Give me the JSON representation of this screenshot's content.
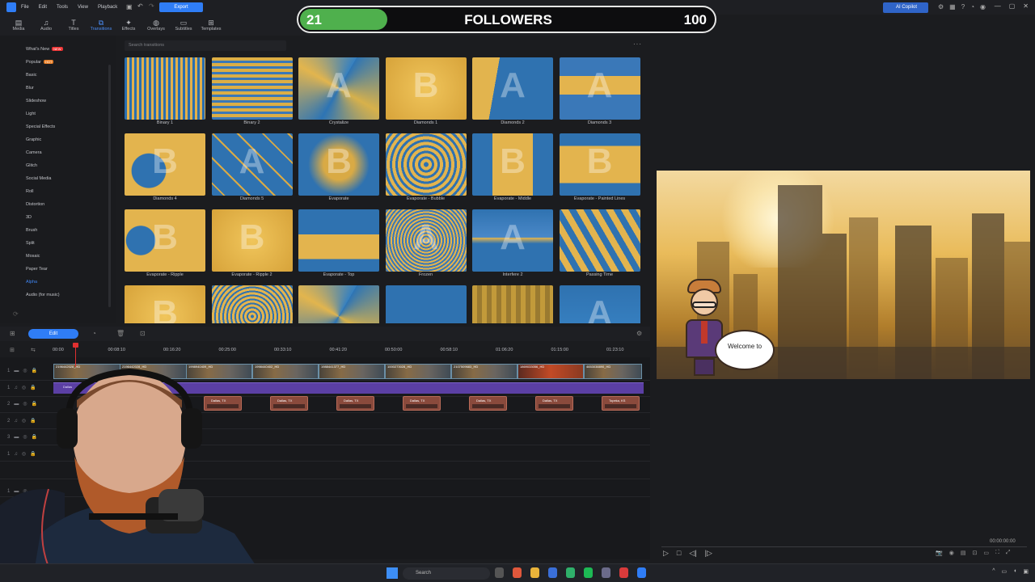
{
  "menu": [
    "File",
    "Edit",
    "Tools",
    "View",
    "Playback"
  ],
  "export_label": "Export",
  "copilot_label": "AI Copilot",
  "toolbar": [
    {
      "icon": "media-icon",
      "label": "Media"
    },
    {
      "icon": "audio-icon",
      "label": "Audio"
    },
    {
      "icon": "titles-icon",
      "label": "Titles"
    },
    {
      "icon": "transitions-icon",
      "label": "Transitions",
      "active": true
    },
    {
      "icon": "effects-icon",
      "label": "Effects"
    },
    {
      "icon": "overlays-icon",
      "label": "Overlays"
    },
    {
      "icon": "subtitles-icon",
      "label": "Subtitles"
    },
    {
      "icon": "templates-icon",
      "label": "Templates"
    }
  ],
  "followers": {
    "current": "21",
    "title": "FOLLOWERS",
    "goal": "100",
    "fraction": 0.21
  },
  "categories": [
    {
      "label": "What's New",
      "tag": "NEW"
    },
    {
      "label": "Popular",
      "tag": "HOT"
    },
    {
      "label": "Basic"
    },
    {
      "label": "Blur"
    },
    {
      "label": "Slideshow"
    },
    {
      "label": "Light"
    },
    {
      "label": "Special Effects"
    },
    {
      "label": "Graphic"
    },
    {
      "label": "Camera"
    },
    {
      "label": "Glitch"
    },
    {
      "label": "Social Media"
    },
    {
      "label": "Roll"
    },
    {
      "label": "Distortion"
    },
    {
      "label": "3D"
    },
    {
      "label": "Brush"
    },
    {
      "label": "Split"
    },
    {
      "label": "Mosaic"
    },
    {
      "label": "Paper Tear"
    },
    {
      "label": "Alpha",
      "selected": true
    },
    {
      "label": "Audio (for music)"
    }
  ],
  "search_placeholder": "Search transitions",
  "transitions": [
    {
      "name": "Binary 1",
      "letter": "",
      "style": "binary"
    },
    {
      "name": "Binary 2",
      "letter": "",
      "style": "binary2"
    },
    {
      "name": "Crystalize",
      "letter": "A",
      "style": "crystal"
    },
    {
      "name": "Diamonds 1",
      "letter": "B",
      "style": "gold"
    },
    {
      "name": "Diamonds 2",
      "letter": "A",
      "style": "blue-split"
    },
    {
      "name": "Diamonds 3",
      "letter": "A",
      "style": "blue-band"
    },
    {
      "name": "Diamonds 4",
      "letter": "B",
      "style": "gold-blue"
    },
    {
      "name": "Diamonds 5",
      "letter": "A",
      "style": "diamond"
    },
    {
      "name": "Evaporate",
      "letter": "B",
      "style": "evap"
    },
    {
      "name": "Evaporate - Bubble",
      "letter": "",
      "style": "bubble"
    },
    {
      "name": "Evaporate - Middle",
      "letter": "B",
      "style": "middle"
    },
    {
      "name": "Evaporate - Painted Lines",
      "letter": "B",
      "style": "painted"
    },
    {
      "name": "Evaporate - Ripple",
      "letter": "B",
      "style": "ripple"
    },
    {
      "name": "Evaporate - Ripple 2",
      "letter": "B",
      "style": "gold"
    },
    {
      "name": "Evaporate - Top",
      "letter": "",
      "style": "top"
    },
    {
      "name": "Frozen",
      "letter": "A",
      "style": "frozen"
    },
    {
      "name": "Interfere 2",
      "letter": "A",
      "style": "interfere"
    },
    {
      "name": "Passing Time",
      "letter": "",
      "style": "passing"
    },
    {
      "name": "",
      "letter": "B",
      "style": "gold"
    },
    {
      "name": "",
      "letter": "",
      "style": "halftone"
    },
    {
      "name": "",
      "letter": "",
      "style": "crystal"
    },
    {
      "name": "",
      "letter": "",
      "style": "star"
    },
    {
      "name": "",
      "letter": "",
      "style": "mosaic"
    },
    {
      "name": "",
      "letter": "A",
      "style": "blue"
    }
  ],
  "timeline": {
    "edit_label": "Edit",
    "ticks": [
      "00:00",
      "00:08:10",
      "00:16:20",
      "00:25:00",
      "00:33:10",
      "00:41:20",
      "00:50:00",
      "00:58:10",
      "01:06:20",
      "01:15:00",
      "01:23:10"
    ],
    "video_clips": [
      "2196442028_HD",
      "2196442028_HD",
      "1998940409_HD",
      "1998440402_HD",
      "1988441377_HD",
      "1000273028_HD",
      "2107509683_HD",
      "1869033056_HD",
      "4653038890_HD"
    ],
    "audio_label": "Dallas",
    "text_clips": [
      "Dallas, TX",
      "Dallas, TX",
      "Dallas, TX",
      "Dallas, TX",
      "Dallas, TX",
      "Dallas, TX",
      "Topeka, KS"
    ]
  },
  "preview": {
    "bubble_text": "Welcome to",
    "timecode": "00:00:00:00"
  },
  "taskbar": {
    "search_placeholder": "Search"
  }
}
